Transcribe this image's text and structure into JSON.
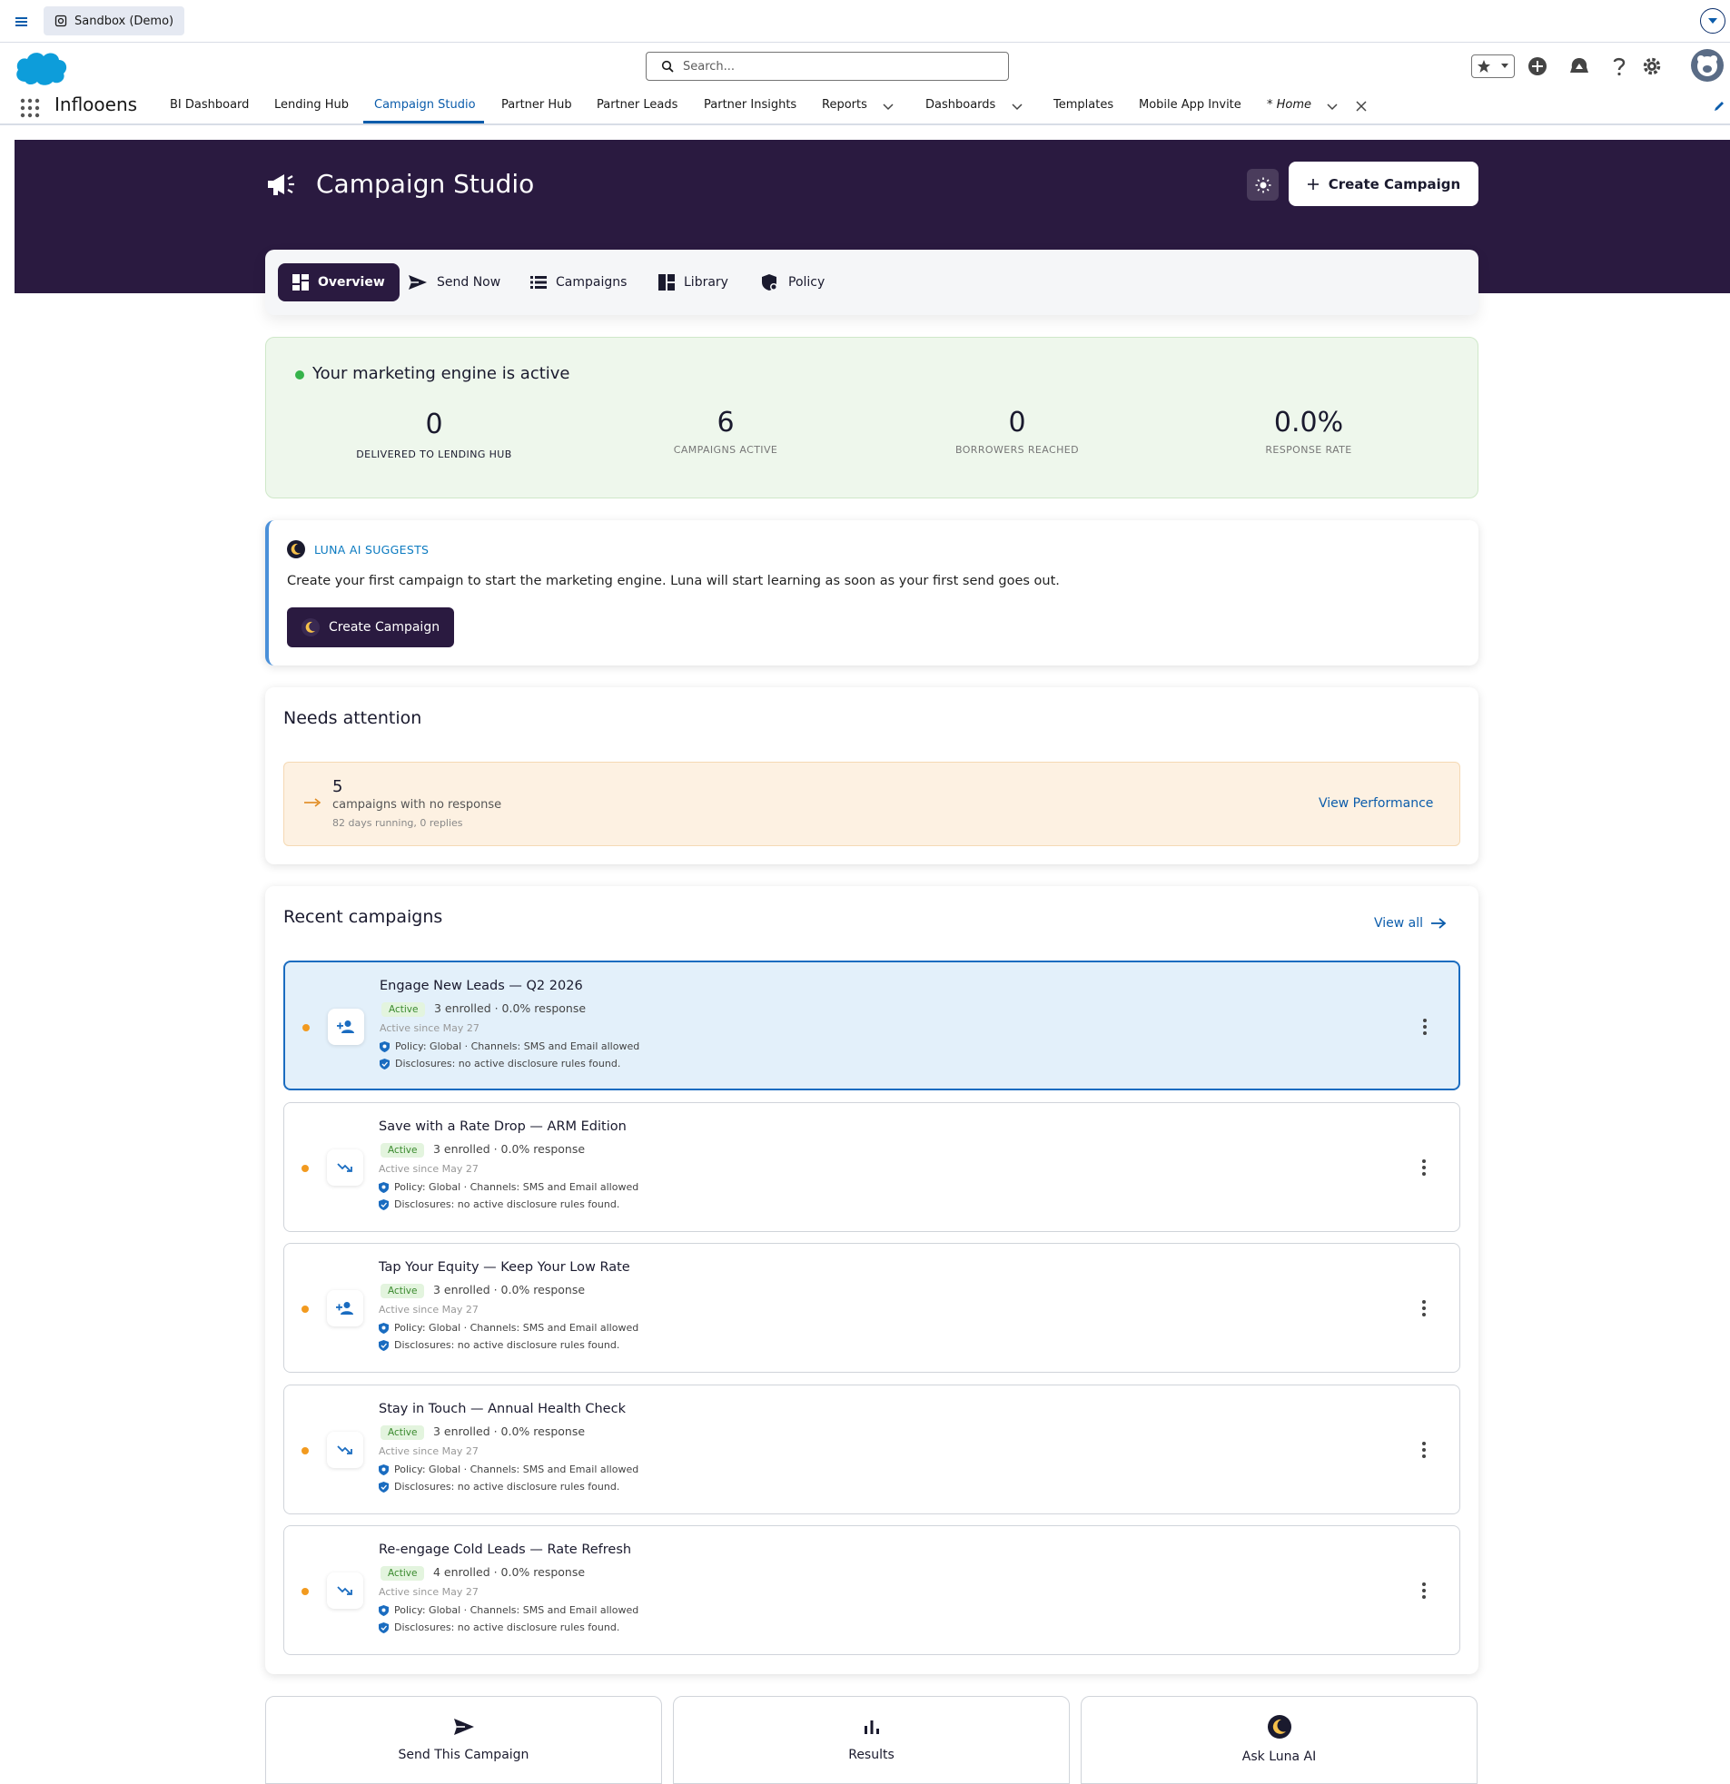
{
  "sysbar": {
    "sandbox_label": "Sandbox (Demo)"
  },
  "header": {
    "search_placeholder": "Search..."
  },
  "nav": {
    "app_name": "Inflooens",
    "items": [
      "BI Dashboard",
      "Lending Hub",
      "Campaign Studio",
      "Partner Hub",
      "Partner Leads",
      "Partner Insights",
      "Reports",
      "Dashboards",
      "Templates",
      "Mobile App Invite"
    ],
    "active": "Campaign Studio",
    "home_tab": "* Home"
  },
  "hero": {
    "title": "Campaign Studio",
    "create_label": "Create Campaign"
  },
  "tabs": [
    "Overview",
    "Send Now",
    "Campaigns",
    "Library",
    "Policy"
  ],
  "engine": {
    "title": "Your marketing engine is active",
    "stats": [
      {
        "value": "0",
        "label": "DELIVERED TO LENDING HUB"
      },
      {
        "value": "6",
        "label": "CAMPAIGNS ACTIVE"
      },
      {
        "value": "0",
        "label": "BORROWERS REACHED"
      },
      {
        "value": "0.0%",
        "label": "RESPONSE RATE"
      }
    ]
  },
  "luna": {
    "label": "LUNA AI SUGGESTS",
    "text": "Create your first campaign to start the marketing engine. Luna will start learning as soon as your first send goes out.",
    "button": "Create Campaign"
  },
  "attention": {
    "title": "Needs attention",
    "count": "5",
    "desc": "campaigns with no response",
    "sub": "82 days running, 0 replies",
    "link": "View Performance"
  },
  "recent": {
    "title": "Recent campaigns",
    "view_all": "View all",
    "campaigns": [
      {
        "name": "Engage New Leads — Q2 2026",
        "status": "Active",
        "enrolled": "3 enrolled · 0.0% response",
        "since": "Active since May 27",
        "policy": "Policy: Global · Channels: SMS and Email allowed",
        "disclosure": "Disclosures: no active disclosure rules found.",
        "icon": "person-add-icon"
      },
      {
        "name": "Save with a Rate Drop — ARM Edition",
        "status": "Active",
        "enrolled": "3 enrolled · 0.0% response",
        "since": "Active since May 27",
        "policy": "Policy: Global · Channels: SMS and Email allowed",
        "disclosure": "Disclosures: no active disclosure rules found.",
        "icon": "trending-down-icon"
      },
      {
        "name": "Tap Your Equity — Keep Your Low Rate",
        "status": "Active",
        "enrolled": "3 enrolled · 0.0% response",
        "since": "Active since May 27",
        "policy": "Policy: Global · Channels: SMS and Email allowed",
        "disclosure": "Disclosures: no active disclosure rules found.",
        "icon": "person-add-icon"
      },
      {
        "name": "Stay in Touch — Annual Health Check",
        "status": "Active",
        "enrolled": "3 enrolled · 0.0% response",
        "since": "Active since May 27",
        "policy": "Policy: Global · Channels: SMS and Email allowed",
        "disclosure": "Disclosures: no active disclosure rules found.",
        "icon": "trending-down-icon"
      },
      {
        "name": "Re-engage Cold Leads — Rate Refresh",
        "status": "Active",
        "enrolled": "4 enrolled · 0.0% response",
        "since": "Active since May 27",
        "policy": "Policy: Global · Channels: SMS and Email allowed",
        "disclosure": "Disclosures: no active disclosure rules found.",
        "icon": "trending-down-icon"
      }
    ]
  },
  "actions": [
    "Send This Campaign",
    "Results",
    "Ask Luna AI"
  ],
  "colors": {
    "hero": "#2a1a40",
    "accent": "#0b5cab",
    "active_green": "#35b34a",
    "status_orange": "#f29a1f"
  }
}
